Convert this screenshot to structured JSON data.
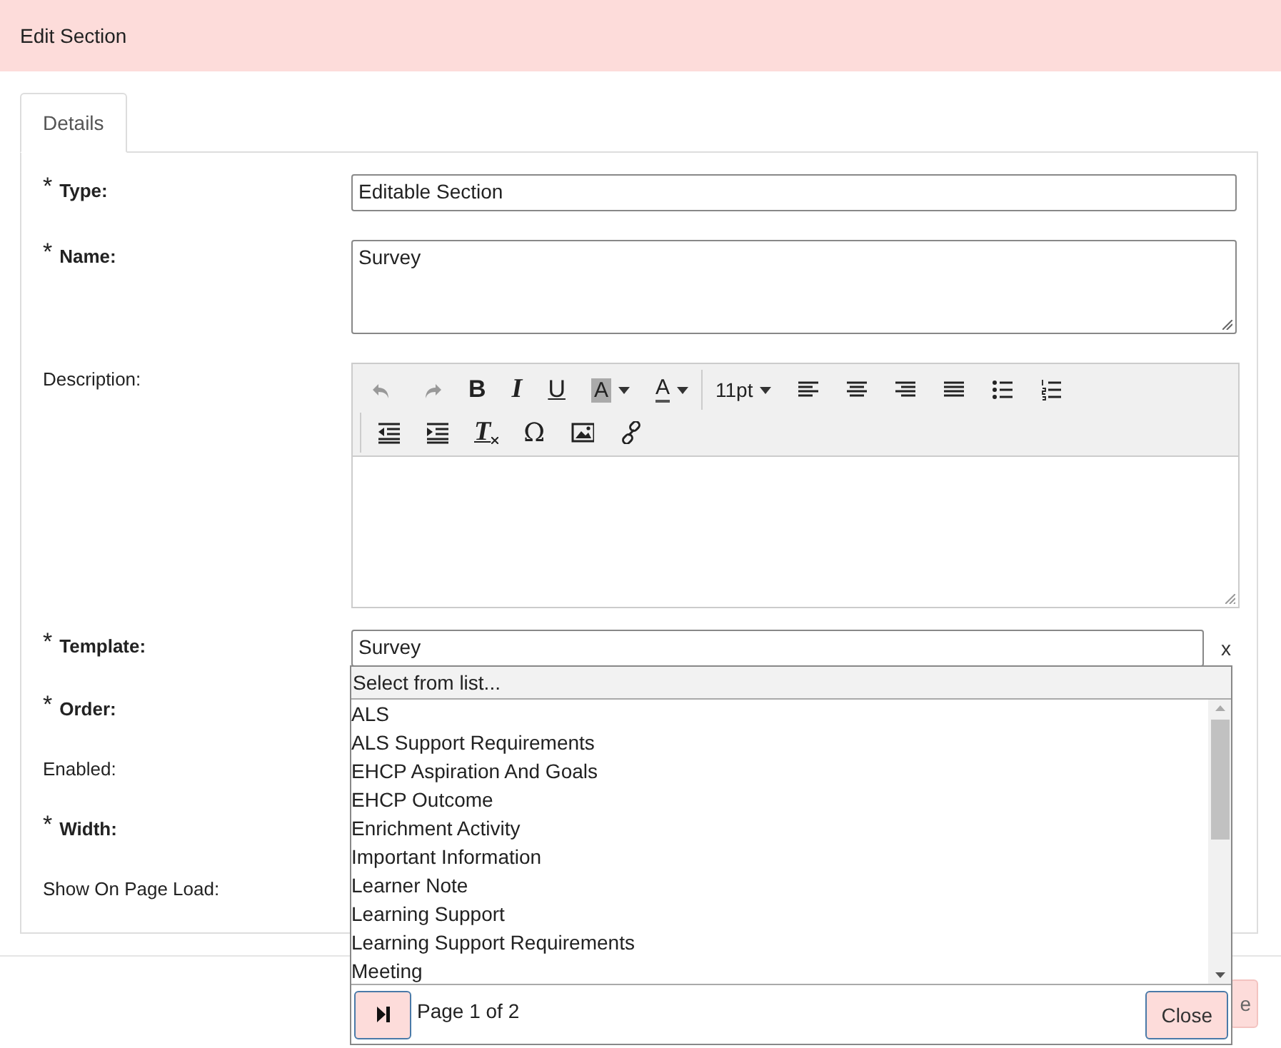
{
  "window": {
    "title": "Edit Section"
  },
  "tabs": [
    {
      "label": "Details",
      "selected": true
    }
  ],
  "fields": [
    {
      "label": "Type:",
      "required_mark": "*",
      "kind": "input",
      "value": "Editable Section"
    },
    {
      "label": "Name:",
      "required_mark": "*",
      "kind": "textarea",
      "value": "Survey"
    },
    {
      "label": "Description:",
      "kind": "editor"
    },
    {
      "label": "Template:",
      "required_mark": "*",
      "kind": "lookup",
      "value": "Survey",
      "clear": "x"
    },
    {
      "label": "Order:",
      "required_mark": "*",
      "kind": "hidden"
    },
    {
      "label": "Enabled:",
      "kind": "hidden"
    },
    {
      "label": "Width:",
      "required_mark": "*",
      "kind": "hidden"
    },
    {
      "label": "Show On Page Load:",
      "kind": "hidden"
    }
  ],
  "toolbar": [
    [
      {
        "kind": "undo",
        "disabled": true
      },
      {
        "kind": "redo",
        "disabled": true
      },
      {
        "kind": "bold",
        "text": "B"
      },
      {
        "kind": "italic",
        "text": "I"
      },
      {
        "kind": "underline",
        "text": "U"
      },
      {
        "kind": "highlight",
        "text": "A"
      },
      {
        "kind": "color",
        "text": "A"
      },
      {
        "kind": "size",
        "text": "11pt"
      },
      {
        "kind": "align-left"
      },
      {
        "kind": "align-center"
      },
      {
        "kind": "align-right"
      },
      {
        "kind": "justify"
      },
      {
        "kind": "bullets"
      },
      {
        "kind": "numbers"
      }
    ],
    [
      {
        "kind": "outdent"
      },
      {
        "kind": "indent"
      },
      {
        "kind": "clear-format",
        "text": "T"
      },
      {
        "kind": "symbol",
        "text": "Ω"
      },
      {
        "kind": "image"
      },
      {
        "kind": "link"
      }
    ]
  ],
  "dropdown": {
    "header": "Select from list...",
    "items": [
      "ALS",
      "ALS Support Requirements",
      "EHCP Aspiration And Goals",
      "EHCP Outcome",
      "Enrichment Activity",
      "Important Information",
      "Learner Note",
      "Learning Support",
      "Learning Support Requirements",
      "Meeting"
    ],
    "page": "Page 1 of 2",
    "close": "Close"
  },
  "footer": {
    "button": "e"
  }
}
